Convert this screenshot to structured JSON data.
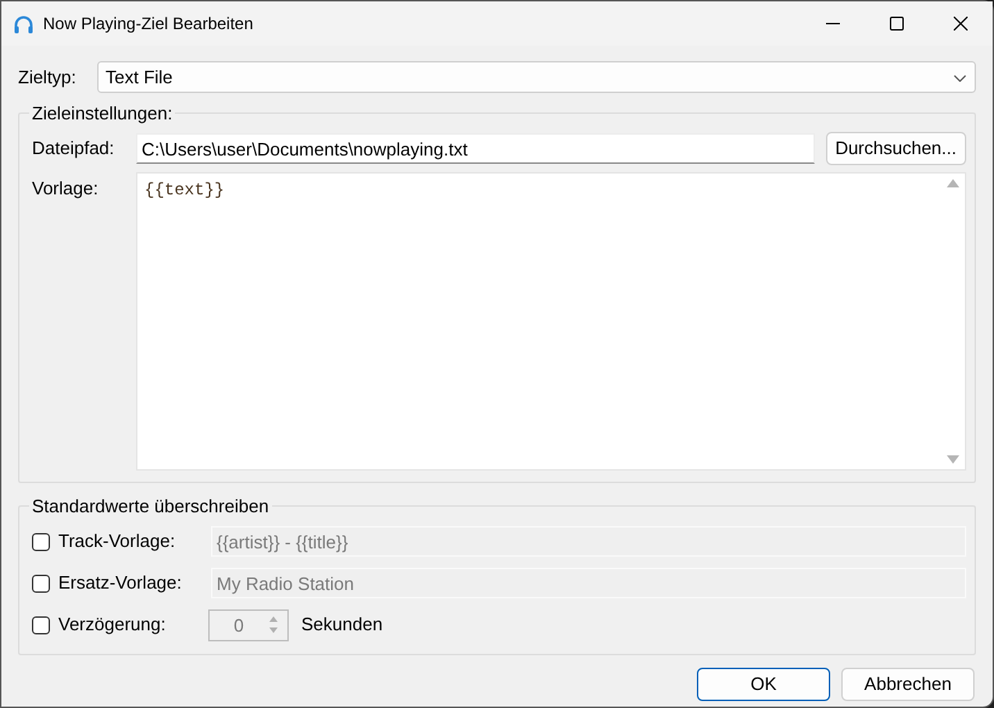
{
  "window": {
    "title": "Now Playing-Ziel Bearbeiten"
  },
  "target_type": {
    "label": "Zieltyp:",
    "value": "Text File"
  },
  "target_settings": {
    "title": "Zieleinstellungen:",
    "file_path": {
      "label": "Dateipfad:",
      "value": "C:\\Users\\user\\Documents\\nowplaying.txt"
    },
    "browse_button": "Durchsuchen...",
    "template": {
      "label": "Vorlage:",
      "value": "{{text}}"
    }
  },
  "overrides": {
    "title": "Standardwerte überschreiben",
    "rows": [
      {
        "kind": "text",
        "label": "Track-Vorlage:",
        "checked": false,
        "value": "{{artist}} - {{title}}",
        "disabled": true
      },
      {
        "kind": "text",
        "label": "Ersatz-Vorlage:",
        "checked": false,
        "value": "My Radio Station",
        "disabled": true
      },
      {
        "kind": "number",
        "label": "Verzögerung:",
        "checked": false,
        "value": "0",
        "disabled": true,
        "unit": "Sekunden"
      }
    ]
  },
  "buttons": [
    {
      "label": "OK",
      "default": true
    },
    {
      "label": "Abbrechen",
      "default": false
    }
  ]
}
